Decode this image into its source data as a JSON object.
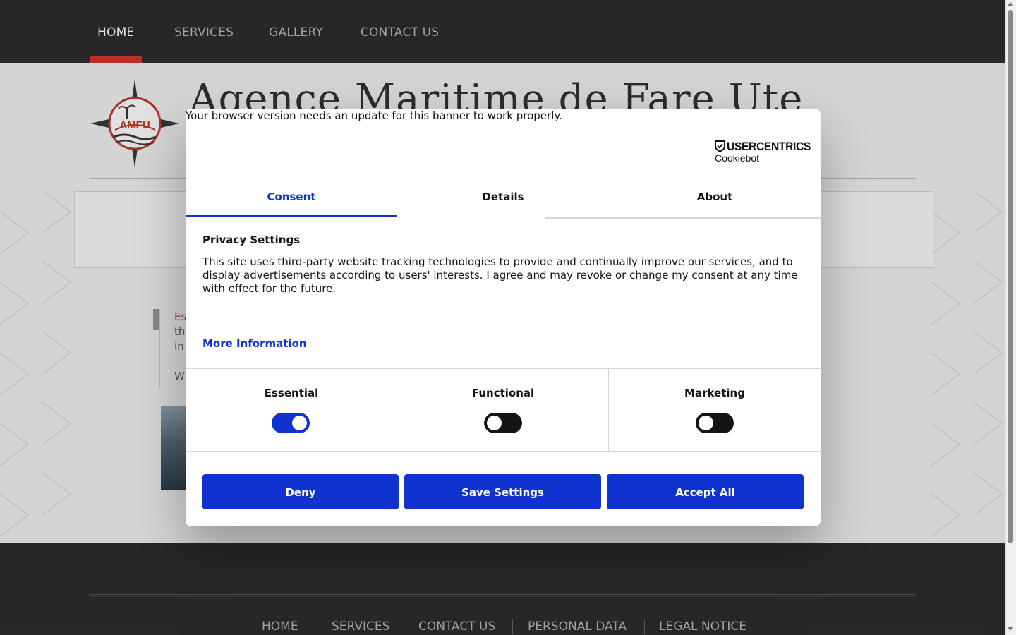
{
  "topnav": {
    "items": [
      {
        "label": "HOME",
        "active": true
      },
      {
        "label": "SERVICES",
        "active": false
      },
      {
        "label": "GALLERY",
        "active": false
      },
      {
        "label": "CONTACT US",
        "active": false
      }
    ]
  },
  "site": {
    "logo_text": "AMFU",
    "title": "Agence Maritime de Fare Ute"
  },
  "content": {
    "fragments": [
      "Es",
      "th",
      "in",
      "W"
    ]
  },
  "footer": {
    "items": [
      "HOME",
      "SERVICES",
      "CONTACT US",
      "PERSONAL DATA",
      "LEGAL NOTICE"
    ]
  },
  "dialog": {
    "update_message": "Your browser version needs an update for this banner to work properly.",
    "brand": {
      "name": "USERCENTRICS",
      "product": "Cookiebot"
    },
    "tabs": [
      {
        "label": "Consent",
        "active": true
      },
      {
        "label": "Details",
        "active": false
      },
      {
        "label": "About",
        "active": false
      }
    ],
    "heading": "Privacy Settings",
    "body": "This site uses third-party website tracking technologies to provide and continually improve our services, and to display advertisements according to users' interests. I agree and may revoke or change my consent at any time with effect for the future.",
    "more_info": "More Information",
    "categories": [
      {
        "label": "Essential",
        "enabled": true
      },
      {
        "label": "Functional",
        "enabled": false
      },
      {
        "label": "Marketing",
        "enabled": false
      }
    ],
    "buttons": {
      "deny": "Deny",
      "save": "Save Settings",
      "accept": "Accept All"
    },
    "colors": {
      "accent": "#1032cf",
      "toggle_off": "#141414"
    }
  }
}
